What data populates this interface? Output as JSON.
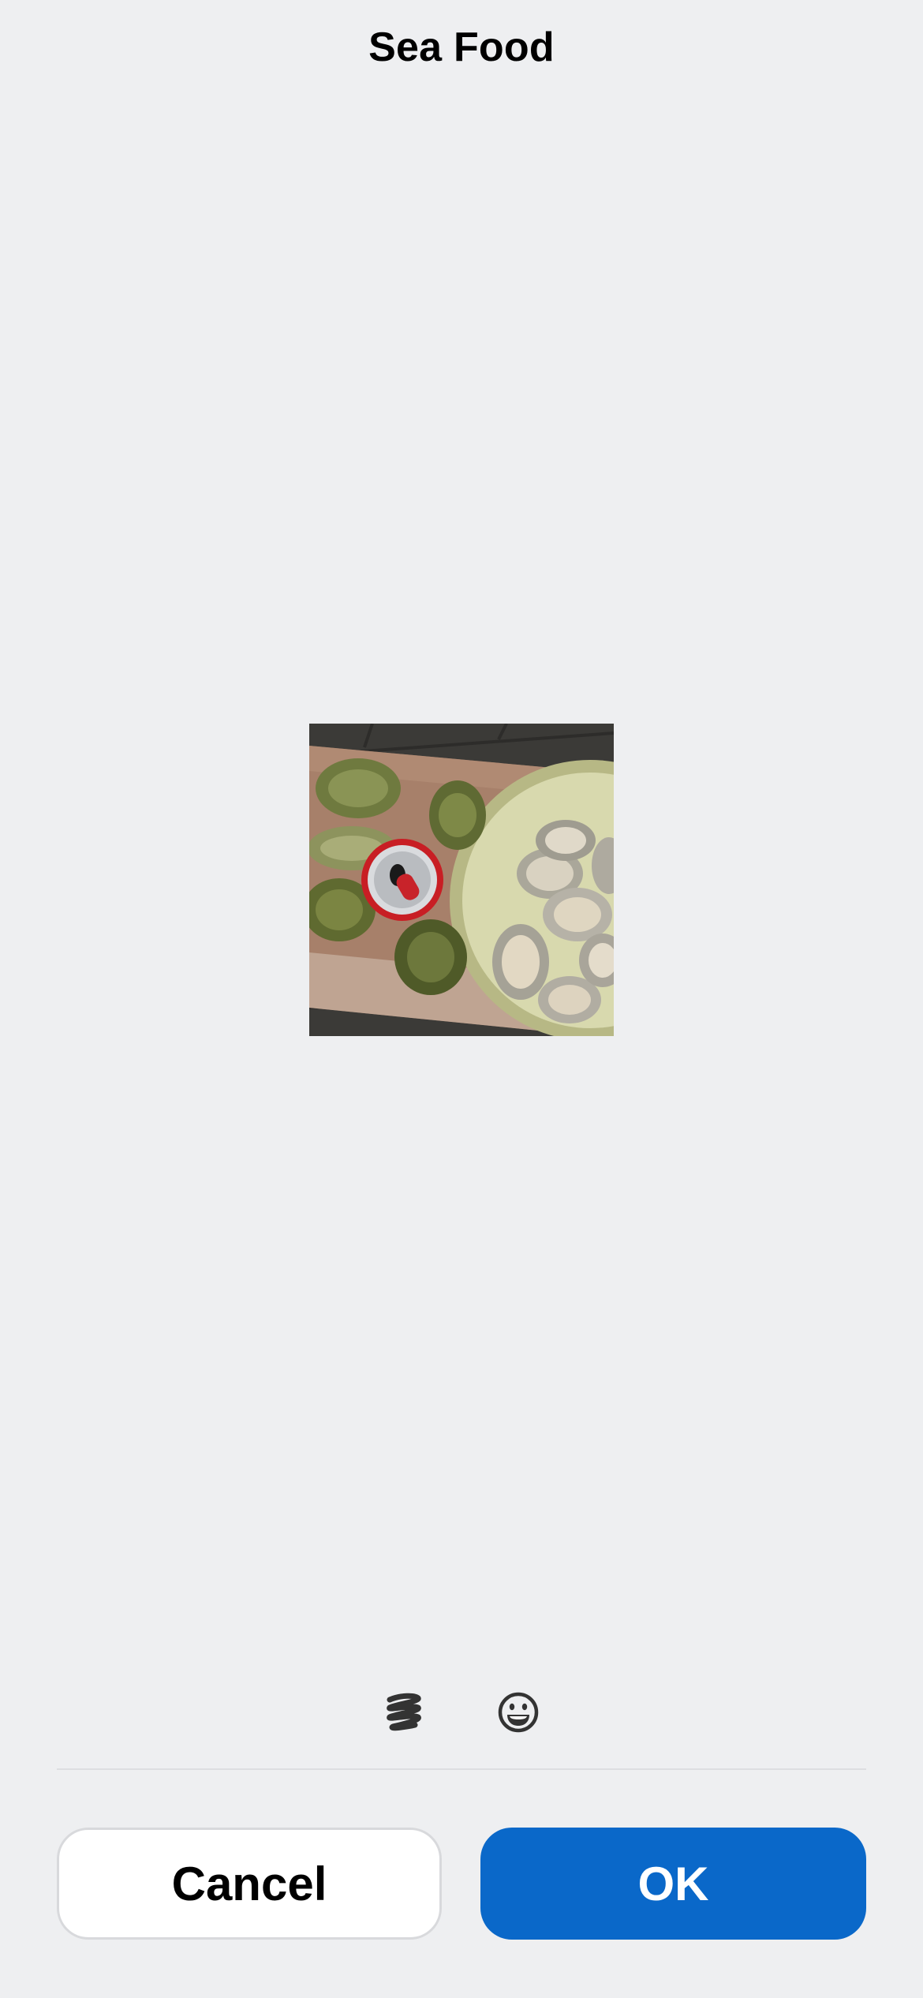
{
  "header": {
    "title": "Sea Food"
  },
  "image": {
    "subject": "oysters-photo"
  },
  "toolbar": {
    "items": [
      {
        "icon": "scribble-icon"
      },
      {
        "icon": "emoji-icon"
      }
    ]
  },
  "actions": {
    "cancel_label": "Cancel",
    "ok_label": "OK"
  },
  "colors": {
    "background": "#eeeff1",
    "primary": "#0a68c9",
    "divider": "#dddee1"
  }
}
